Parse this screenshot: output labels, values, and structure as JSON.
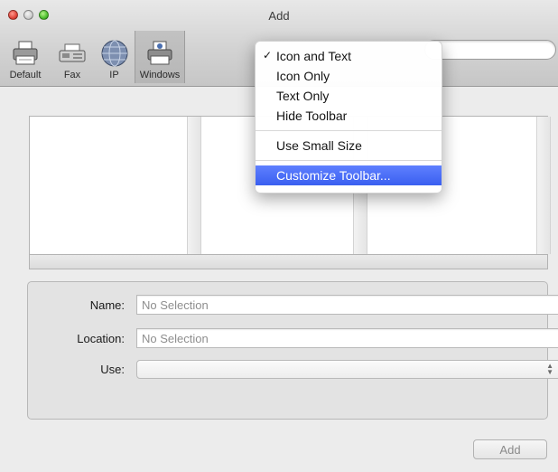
{
  "window": {
    "title": "Add"
  },
  "toolbar": {
    "items": [
      {
        "label": "Default",
        "icon": "printer-icon"
      },
      {
        "label": "Fax",
        "icon": "fax-icon"
      },
      {
        "label": "IP",
        "icon": "globe-icon"
      },
      {
        "label": "Windows",
        "icon": "windows-printer-icon",
        "selected": true
      }
    ]
  },
  "context_menu": {
    "items": [
      {
        "label": "Icon and Text",
        "checked": true
      },
      {
        "label": "Icon Only"
      },
      {
        "label": "Text Only"
      },
      {
        "label": "Hide Toolbar"
      },
      {
        "label": "Use Small Size"
      },
      {
        "label": "Customize Toolbar...",
        "highlighted": true
      }
    ],
    "check_mark": "✓"
  },
  "info": {
    "name_label": "Name:",
    "name_value": "No Selection",
    "location_label": "Location:",
    "location_value": "No Selection",
    "use_label": "Use:",
    "use_value": ""
  },
  "buttons": {
    "add_label": "Add"
  },
  "colors": {
    "menu_highlight": "#3a5ff0",
    "close": "#e0443a",
    "zoom": "#4cbf2d"
  }
}
